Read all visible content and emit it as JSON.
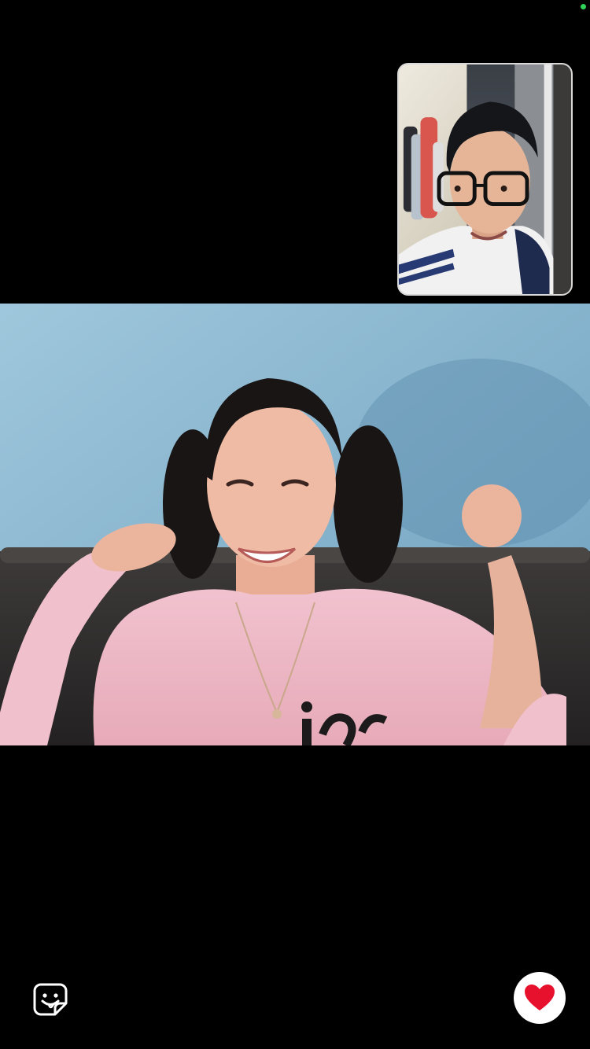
{
  "status": {
    "indicator_color": "#2fd158"
  },
  "call": {
    "self_view": {
      "icon": "self-camera-video"
    },
    "remote_view": {
      "icon": "remote-camera-video"
    }
  },
  "controls": {
    "reaction_icon": "sticker-face-icon",
    "reaction_color": "#ffffff",
    "like_icon": "heart-icon",
    "like_color": "#e8112d",
    "like_bg": "#ffffff"
  }
}
